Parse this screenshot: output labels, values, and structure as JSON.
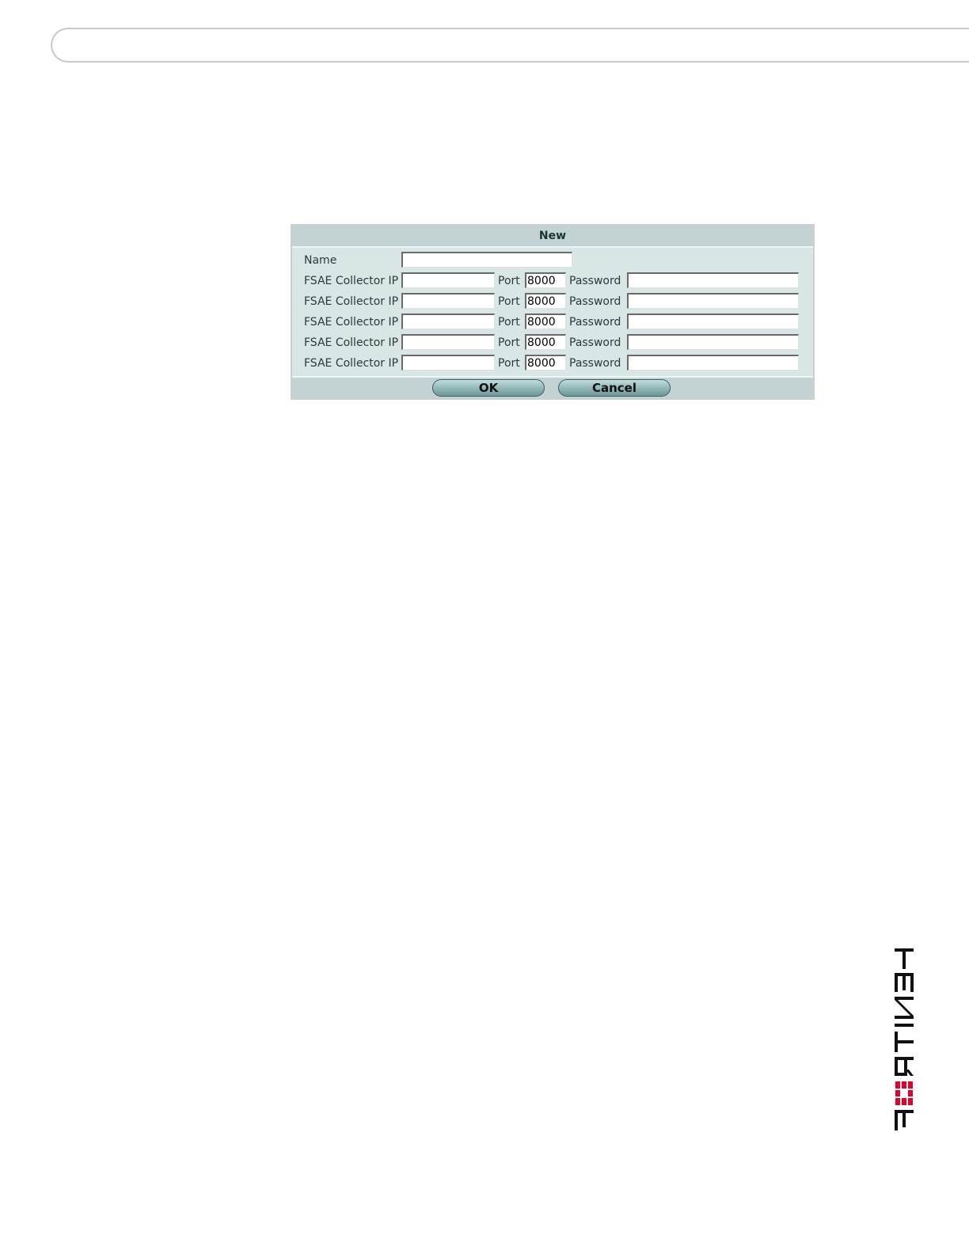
{
  "dialog": {
    "title": "New",
    "name_label": "Name",
    "name_value": "",
    "collectors": [
      {
        "ip_label": "FSAE Collector IP",
        "ip_value": "",
        "port_label": "Port",
        "port_value": "8000",
        "password_label": "Password",
        "password_value": ""
      },
      {
        "ip_label": "FSAE Collector IP",
        "ip_value": "",
        "port_label": "Port",
        "port_value": "8000",
        "password_label": "Password",
        "password_value": ""
      },
      {
        "ip_label": "FSAE Collector IP",
        "ip_value": "",
        "port_label": "Port",
        "port_value": "8000",
        "password_label": "Password",
        "password_value": ""
      },
      {
        "ip_label": "FSAE Collector IP",
        "ip_value": "",
        "port_label": "Port",
        "port_value": "8000",
        "password_label": "Password",
        "password_value": ""
      },
      {
        "ip_label": "FSAE Collector IP",
        "ip_value": "",
        "port_label": "Port",
        "port_value": "8000",
        "password_label": "Password",
        "password_value": ""
      }
    ],
    "ok_label": "OK",
    "cancel_label": "Cancel"
  },
  "logo": {
    "text": "FORTINET",
    "brand_color": "#e4002b"
  },
  "colors": {
    "dialog_bg": "#d9e6e6",
    "dialog_header": "#c3d2d2",
    "button": "#8fb4b4"
  }
}
